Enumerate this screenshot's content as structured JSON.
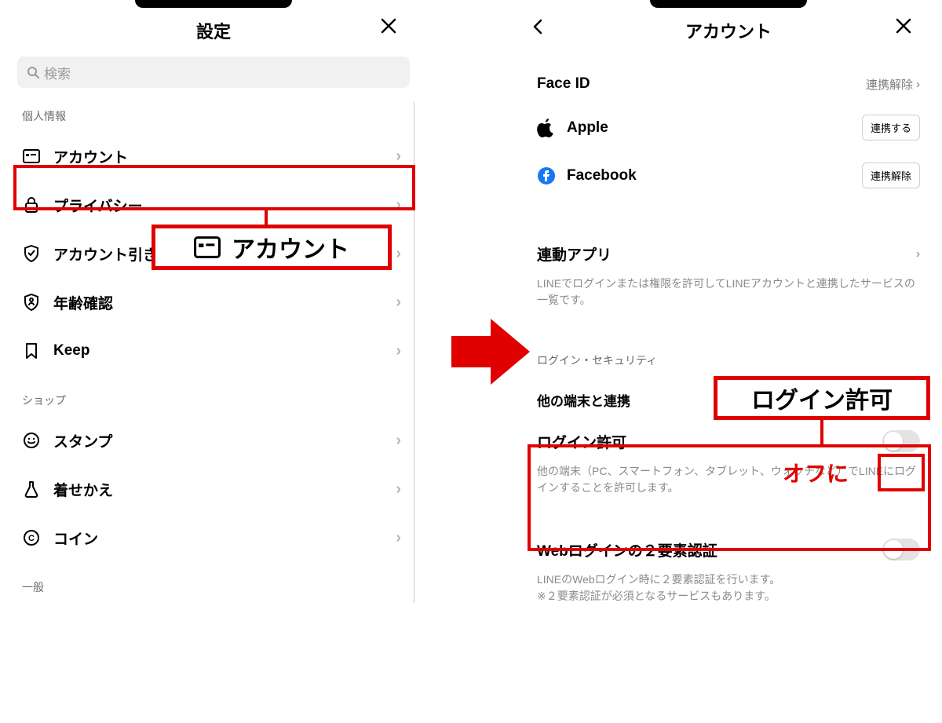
{
  "left": {
    "title": "設定",
    "search_placeholder": "検索",
    "sections": {
      "personal": "個人情報",
      "shop": "ショップ",
      "general": "一般"
    },
    "items": {
      "account": "アカウント",
      "privacy": "プライバシー",
      "transfer": "アカウント引き継ぎ",
      "age": "年齢確認",
      "keep": "Keep",
      "stamp": "スタンプ",
      "theme": "着せかえ",
      "coin": "コイン"
    }
  },
  "right": {
    "title": "アカウント",
    "faceid_label": "Face ID",
    "faceid_action": "連携解除",
    "apple_label": "Apple",
    "apple_button": "連携する",
    "facebook_label": "Facebook",
    "facebook_button": "連携解除",
    "linked_apps_label": "連動アプリ",
    "linked_apps_desc": "LINEでログインまたは権限を許可してLINEアカウントと連携したサービスの一覧です。",
    "login_security_label": "ログイン・セキュリティ",
    "other_devices_label": "他の端末と連携",
    "login_allow_label": "ログイン許可",
    "login_allow_desc": "他の端末（PC、スマートフォン、タブレット、ウォッチなど）でLINEにログインすることを許可します。",
    "twofa_label": "Webログインの２要素認証",
    "twofa_desc1": "LINEのWebログイン時に２要素認証を行います。",
    "twofa_desc2": "※２要素認証が必須となるサービスもあります。"
  },
  "annotations": {
    "account_callout": "アカウント",
    "login_callout": "ログイン許可",
    "off_text": "オフに"
  }
}
